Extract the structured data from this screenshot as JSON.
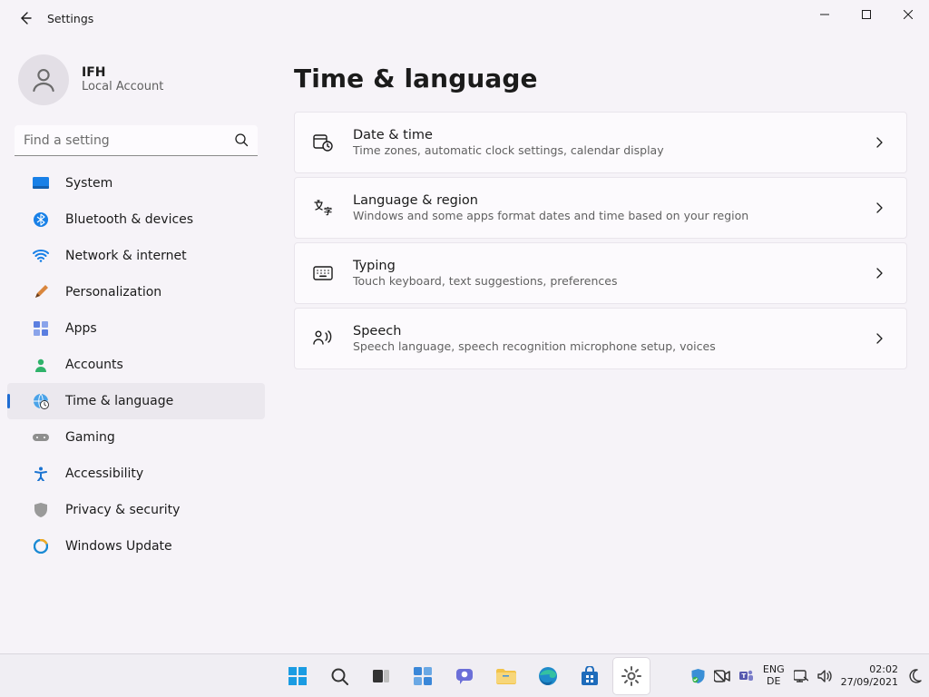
{
  "titlebar": {
    "app_title": "Settings"
  },
  "account": {
    "name": "IFH",
    "sub": "Local Account"
  },
  "search": {
    "placeholder": "Find a setting"
  },
  "sidebar": {
    "items": [
      {
        "label": "System"
      },
      {
        "label": "Bluetooth & devices"
      },
      {
        "label": "Network & internet"
      },
      {
        "label": "Personalization"
      },
      {
        "label": "Apps"
      },
      {
        "label": "Accounts"
      },
      {
        "label": "Time & language"
      },
      {
        "label": "Gaming"
      },
      {
        "label": "Accessibility"
      },
      {
        "label": "Privacy & security"
      },
      {
        "label": "Windows Update"
      }
    ],
    "active_index": 6
  },
  "page": {
    "title": "Time & language",
    "cards": [
      {
        "title": "Date & time",
        "sub": "Time zones, automatic clock settings, calendar display"
      },
      {
        "title": "Language & region",
        "sub": "Windows and some apps format dates and time based on your region"
      },
      {
        "title": "Typing",
        "sub": "Touch keyboard, text suggestions, preferences"
      },
      {
        "title": "Speech",
        "sub": "Speech language, speech recognition microphone setup, voices"
      }
    ]
  },
  "taskbar": {
    "lang_top": "ENG",
    "lang_bottom": "DE",
    "time": "02:02",
    "date": "27/09/2021"
  }
}
